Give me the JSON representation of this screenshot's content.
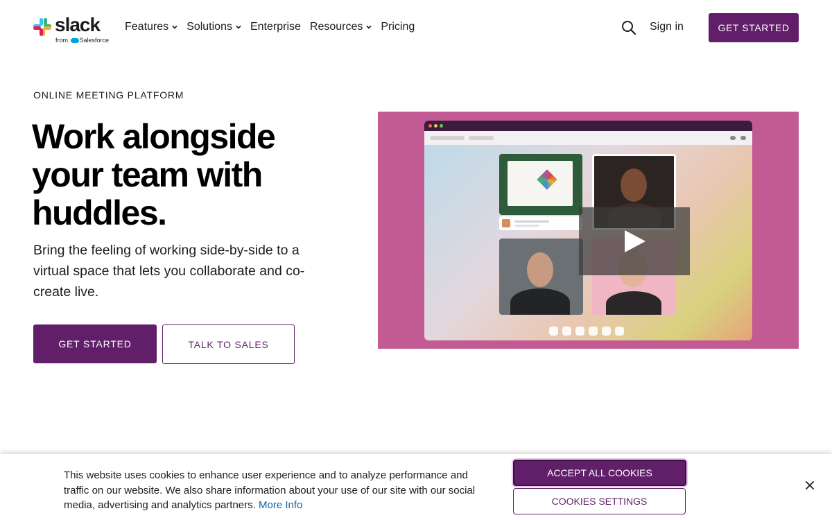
{
  "header": {
    "logo_text": "slack",
    "logo_sub_from": "from",
    "logo_sub_brand": "Salesforce",
    "nav": [
      {
        "label": "Features",
        "has_dropdown": true
      },
      {
        "label": "Solutions",
        "has_dropdown": true
      },
      {
        "label": "Enterprise",
        "has_dropdown": false
      },
      {
        "label": "Resources",
        "has_dropdown": true
      },
      {
        "label": "Pricing",
        "has_dropdown": false
      }
    ],
    "sign_in": "Sign in",
    "cta": "GET STARTED"
  },
  "hero": {
    "eyebrow": "ONLINE MEETING PLATFORM",
    "title_line1": "Work alongside",
    "title_line2": "your team with",
    "title_line3": "huddles.",
    "subtitle": "Bring the feeling of working side-by-side to a virtual space that lets you collaborate and co-create live.",
    "primary_cta": "GET STARTED",
    "secondary_cta": "TALK TO SALES"
  },
  "video": {
    "background_color": "#c25a93",
    "icon": "play-icon"
  },
  "cookie_banner": {
    "text": "This website uses cookies to enhance user experience and to analyze performance and traffic on our website. We also share information about your use of our site with our social media, advertising and analytics partners.",
    "link": "More Info",
    "accept": "ACCEPT ALL COOKIES",
    "settings": "COOKIES SETTINGS"
  },
  "colors": {
    "brand_purple": "#611f69",
    "link_blue": "#1264a3"
  }
}
